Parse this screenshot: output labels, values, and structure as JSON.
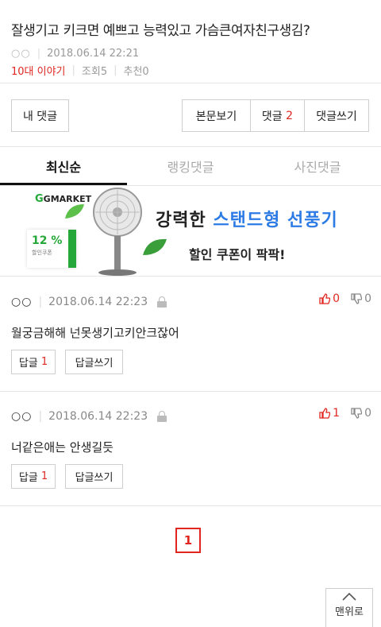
{
  "post": {
    "title": "잘생기고 키크면 예쁘고 능력있고 가슴큰여자친구생김?",
    "author": "○○",
    "datetime": "2018.06.14 22:21",
    "board": "10대 이야기",
    "views": "조회5",
    "recommends": "추천0"
  },
  "actions": {
    "my_comments": "내 댓글",
    "view_body": "본문보기",
    "comments_label": "댓글",
    "comments_count": "2",
    "write_comment": "댓글쓰기"
  },
  "tabs": [
    {
      "label": "최신순",
      "active": true
    },
    {
      "label": "랭킹댓글",
      "active": false
    },
    {
      "label": "사진댓글",
      "active": false
    }
  ],
  "banner": {
    "logo": "GMARKET",
    "headline_prefix": "강력한 ",
    "headline_highlight": "스탠드형 선풍기",
    "subline": "할인 쿠폰이 팍팍!",
    "coupon_percent": "12 %",
    "coupon_label": "할인쿠폰"
  },
  "comments": [
    {
      "author": "○○",
      "datetime": "2018.06.14 22:23",
      "text": "월궁금해해 넌못생기고키안크잖어",
      "up": "0",
      "down": "0",
      "reply_label": "답글",
      "reply_count": "1",
      "write_reply": "답글쓰기"
    },
    {
      "author": "○○",
      "datetime": "2018.06.14 22:23",
      "text": "너같은애는 안생길듯",
      "up": "1",
      "down": "0",
      "reply_label": "답글",
      "reply_count": "1",
      "write_reply": "답글쓰기"
    }
  ],
  "pagination": {
    "current": "1"
  },
  "scroll_top": {
    "label": "맨위로"
  },
  "colors": {
    "accent": "#e0261f",
    "brand_green": "#25a839",
    "highlight_blue": "#2c7be5"
  }
}
